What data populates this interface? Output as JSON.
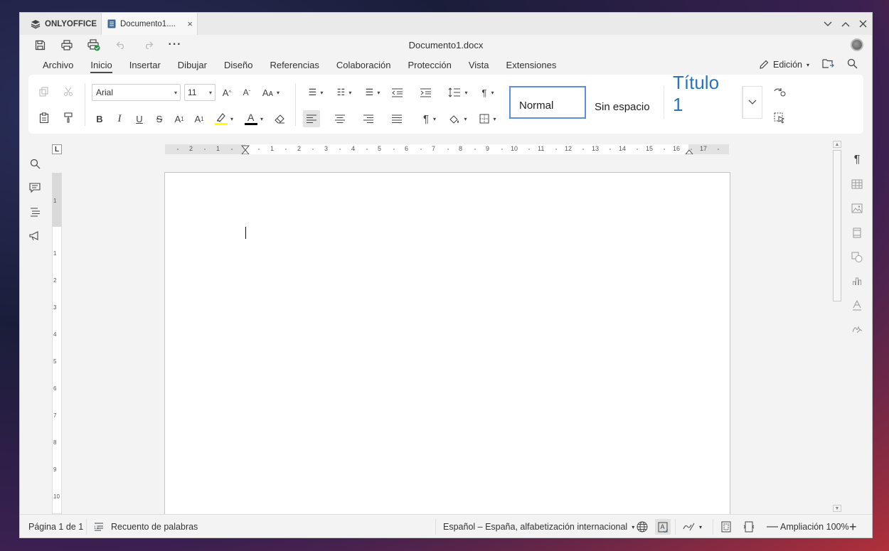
{
  "app": {
    "brand": "ONLYOFFICE"
  },
  "tab": {
    "title": "Documento1...."
  },
  "title": "Documento1.docx",
  "menu": [
    "Archivo",
    "Inicio",
    "Insertar",
    "Dibujar",
    "Diseño",
    "Referencias",
    "Colaboración",
    "Protección",
    "Vista",
    "Extensiones"
  ],
  "menu_active": "Inicio",
  "mode": {
    "label": "Edición"
  },
  "font": {
    "name": "Arial",
    "size": "11"
  },
  "styles": {
    "normal": "Normal",
    "no_spacing": "Sin espacio",
    "heading1": "Título 1"
  },
  "ruler": {
    "h_numbers": [
      "2",
      "1",
      "1",
      "2",
      "3",
      "4",
      "5",
      "6",
      "7",
      "8",
      "9",
      "10",
      "11",
      "12",
      "13",
      "14",
      "15",
      "16",
      "17"
    ],
    "v_numbers": [
      "1",
      "1",
      "2",
      "3",
      "4",
      "5",
      "6",
      "7",
      "8",
      "9",
      "10"
    ],
    "corner": "L"
  },
  "status": {
    "page": "Página 1 de 1",
    "word_count": "Recuento de palabras",
    "language": "Español – España, alfabetización internacional",
    "zoom": "Ampliación 100%"
  },
  "colors": {
    "accent": "#5b8fd6",
    "heading": "#2e74b5",
    "highlight": "#ffff00",
    "font_color": "#000000"
  }
}
